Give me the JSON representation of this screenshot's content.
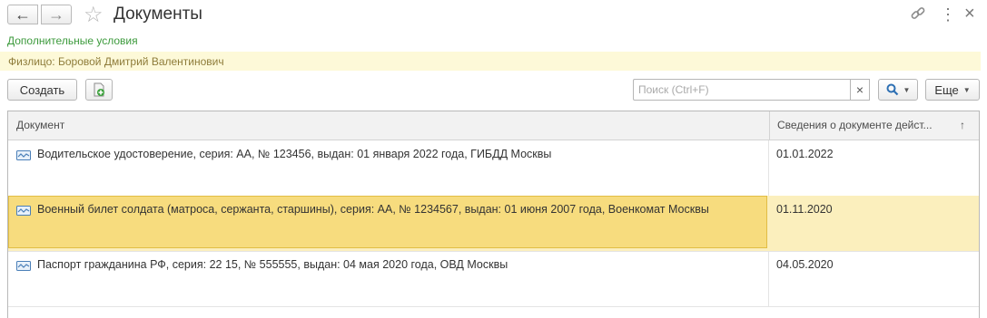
{
  "window": {
    "title": "Документы"
  },
  "header": {
    "additional_conditions": "Дополнительные условия",
    "filter": "Физлицо: Боровой Дмитрий Валентинович"
  },
  "toolbar": {
    "create_label": "Создать",
    "search_placeholder": "Поиск (Ctrl+F)",
    "search_value": "",
    "more_label": "Еще"
  },
  "table": {
    "columns": [
      "Документ",
      "Сведения о документе дейст..."
    ],
    "rows": [
      {
        "document": "Водительское удостоверение, серия: АА, № 123456, выдан: 01 января 2022 года, ГИБДД Москвы",
        "date": "01.01.2022",
        "selected": false
      },
      {
        "document": "Военный билет солдата (матроса, сержанта, старшины), серия: АА, № 1234567, выдан: 01 июня 2007 года, Военкомат Москвы",
        "date": "01.11.2020",
        "selected": true
      },
      {
        "document": "Паспорт гражданина РФ, серия: 22 15, № 555555, выдан: 04 мая 2020 года, ОВД Москвы",
        "date": "04.05.2020",
        "selected": false
      }
    ]
  },
  "icons": {
    "back": "arrow-left-icon",
    "forward": "arrow-right-icon",
    "favorite": "star-icon",
    "link": "link-icon",
    "more": "more-vertical-icon",
    "close": "close-icon",
    "add_copy": "add-document-icon",
    "search": "search-icon",
    "row": "document-card-icon"
  },
  "colors": {
    "accent_green": "#3c9a3c",
    "selection": "#f7dc7e",
    "filter_bg": "#fdf9d8"
  }
}
